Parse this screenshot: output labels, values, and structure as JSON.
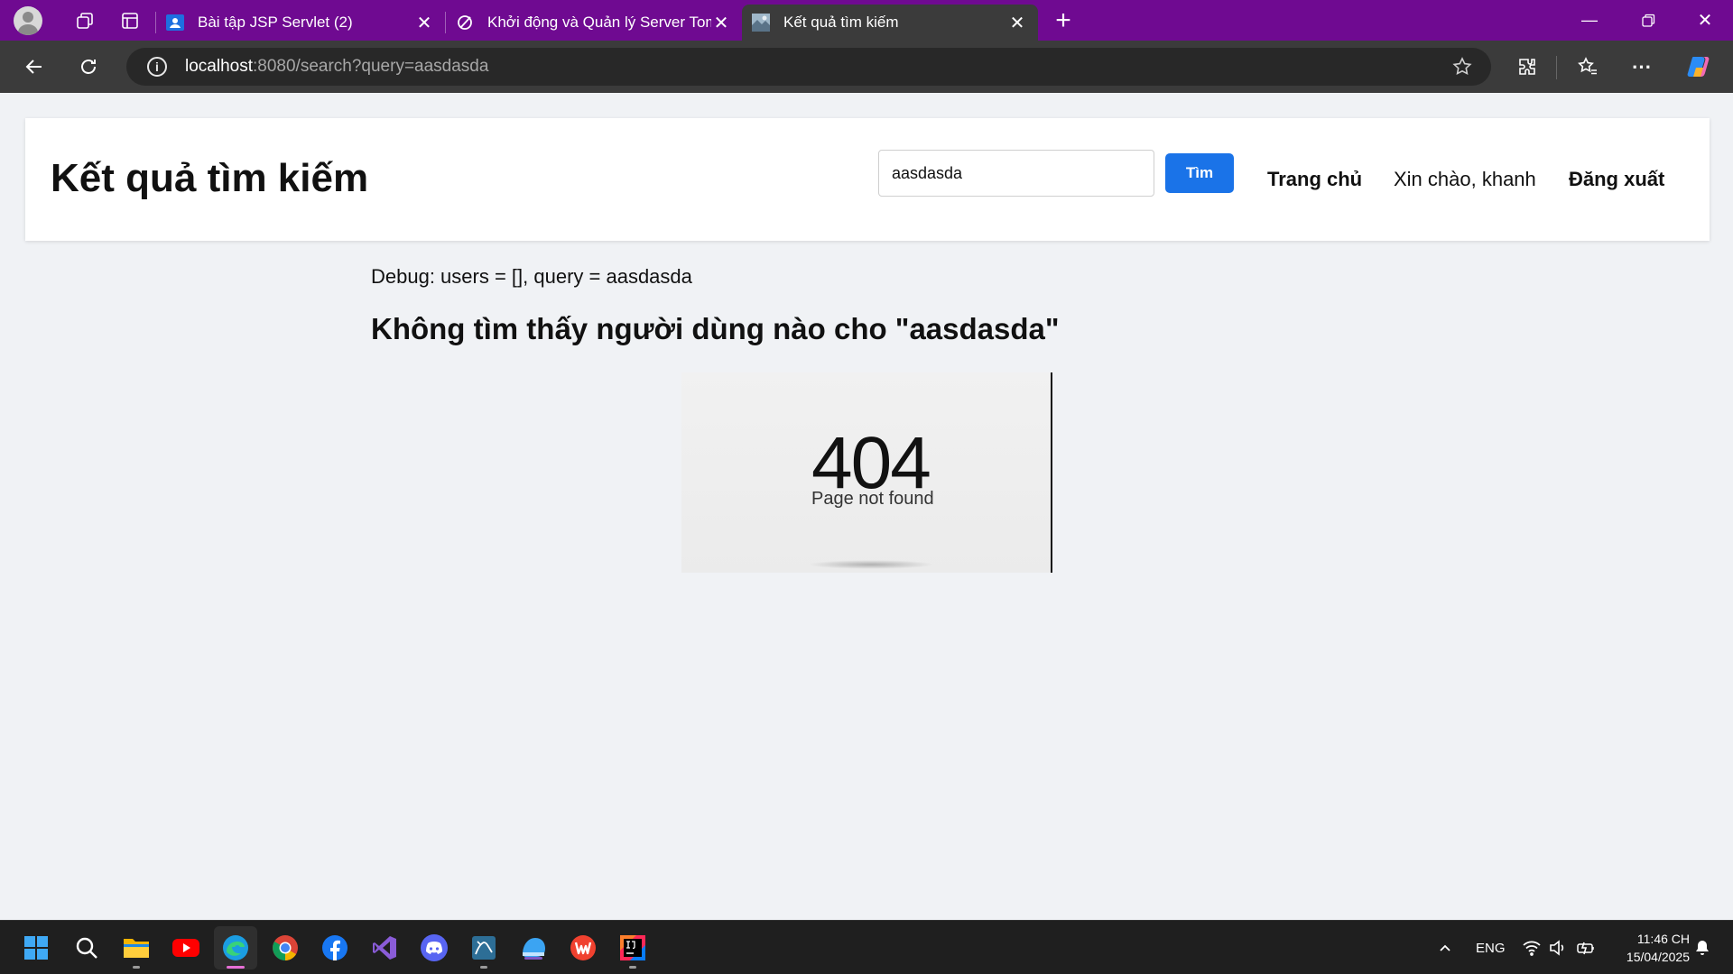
{
  "browser": {
    "tabs": [
      {
        "label": "Bài tập JSP Servlet (2)",
        "icon": "classroom-icon",
        "active": false
      },
      {
        "label": "Khởi động và Quản lý Server Tomcat",
        "icon": "tomcat-icon",
        "active": false
      },
      {
        "label": "Kết quả tìm kiếm",
        "icon": "page-favicon",
        "active": true
      }
    ],
    "address": {
      "host": "localhost",
      "rest": ":8080/search?query=aasdasda"
    }
  },
  "page": {
    "title": "Kết quả tìm kiếm",
    "search": {
      "value": "aasdasda",
      "button_label": "Tìm"
    },
    "nav": {
      "home": "Trang chủ",
      "greeting": "Xin chào, khanh",
      "logout": "Đăng xuất"
    },
    "debug": "Debug: users = [], query = aasdasda",
    "not_found": "Không tìm thấy người dùng nào cho \"aasdasda\"",
    "image404": {
      "code": "404",
      "text": "Page not found"
    }
  },
  "taskbar": {
    "apps": [
      "windows-start-icon",
      "search-icon",
      "file-explorer-icon",
      "youtube-icon",
      "edge-icon",
      "chrome-icon",
      "facebook-icon",
      "visual-studio-icon",
      "discord-icon",
      "mysql-workbench-icon",
      "photos-icon",
      "wps-office-icon",
      "intellij-icon"
    ],
    "language": "ENG",
    "time": "11:46 CH",
    "date": "15/04/2025"
  },
  "colors": {
    "titlebar": "#6f0a91",
    "toolbar": "#3b3b3b",
    "page_bg": "#f0f2f5",
    "primary_button": "#1a73e8"
  }
}
